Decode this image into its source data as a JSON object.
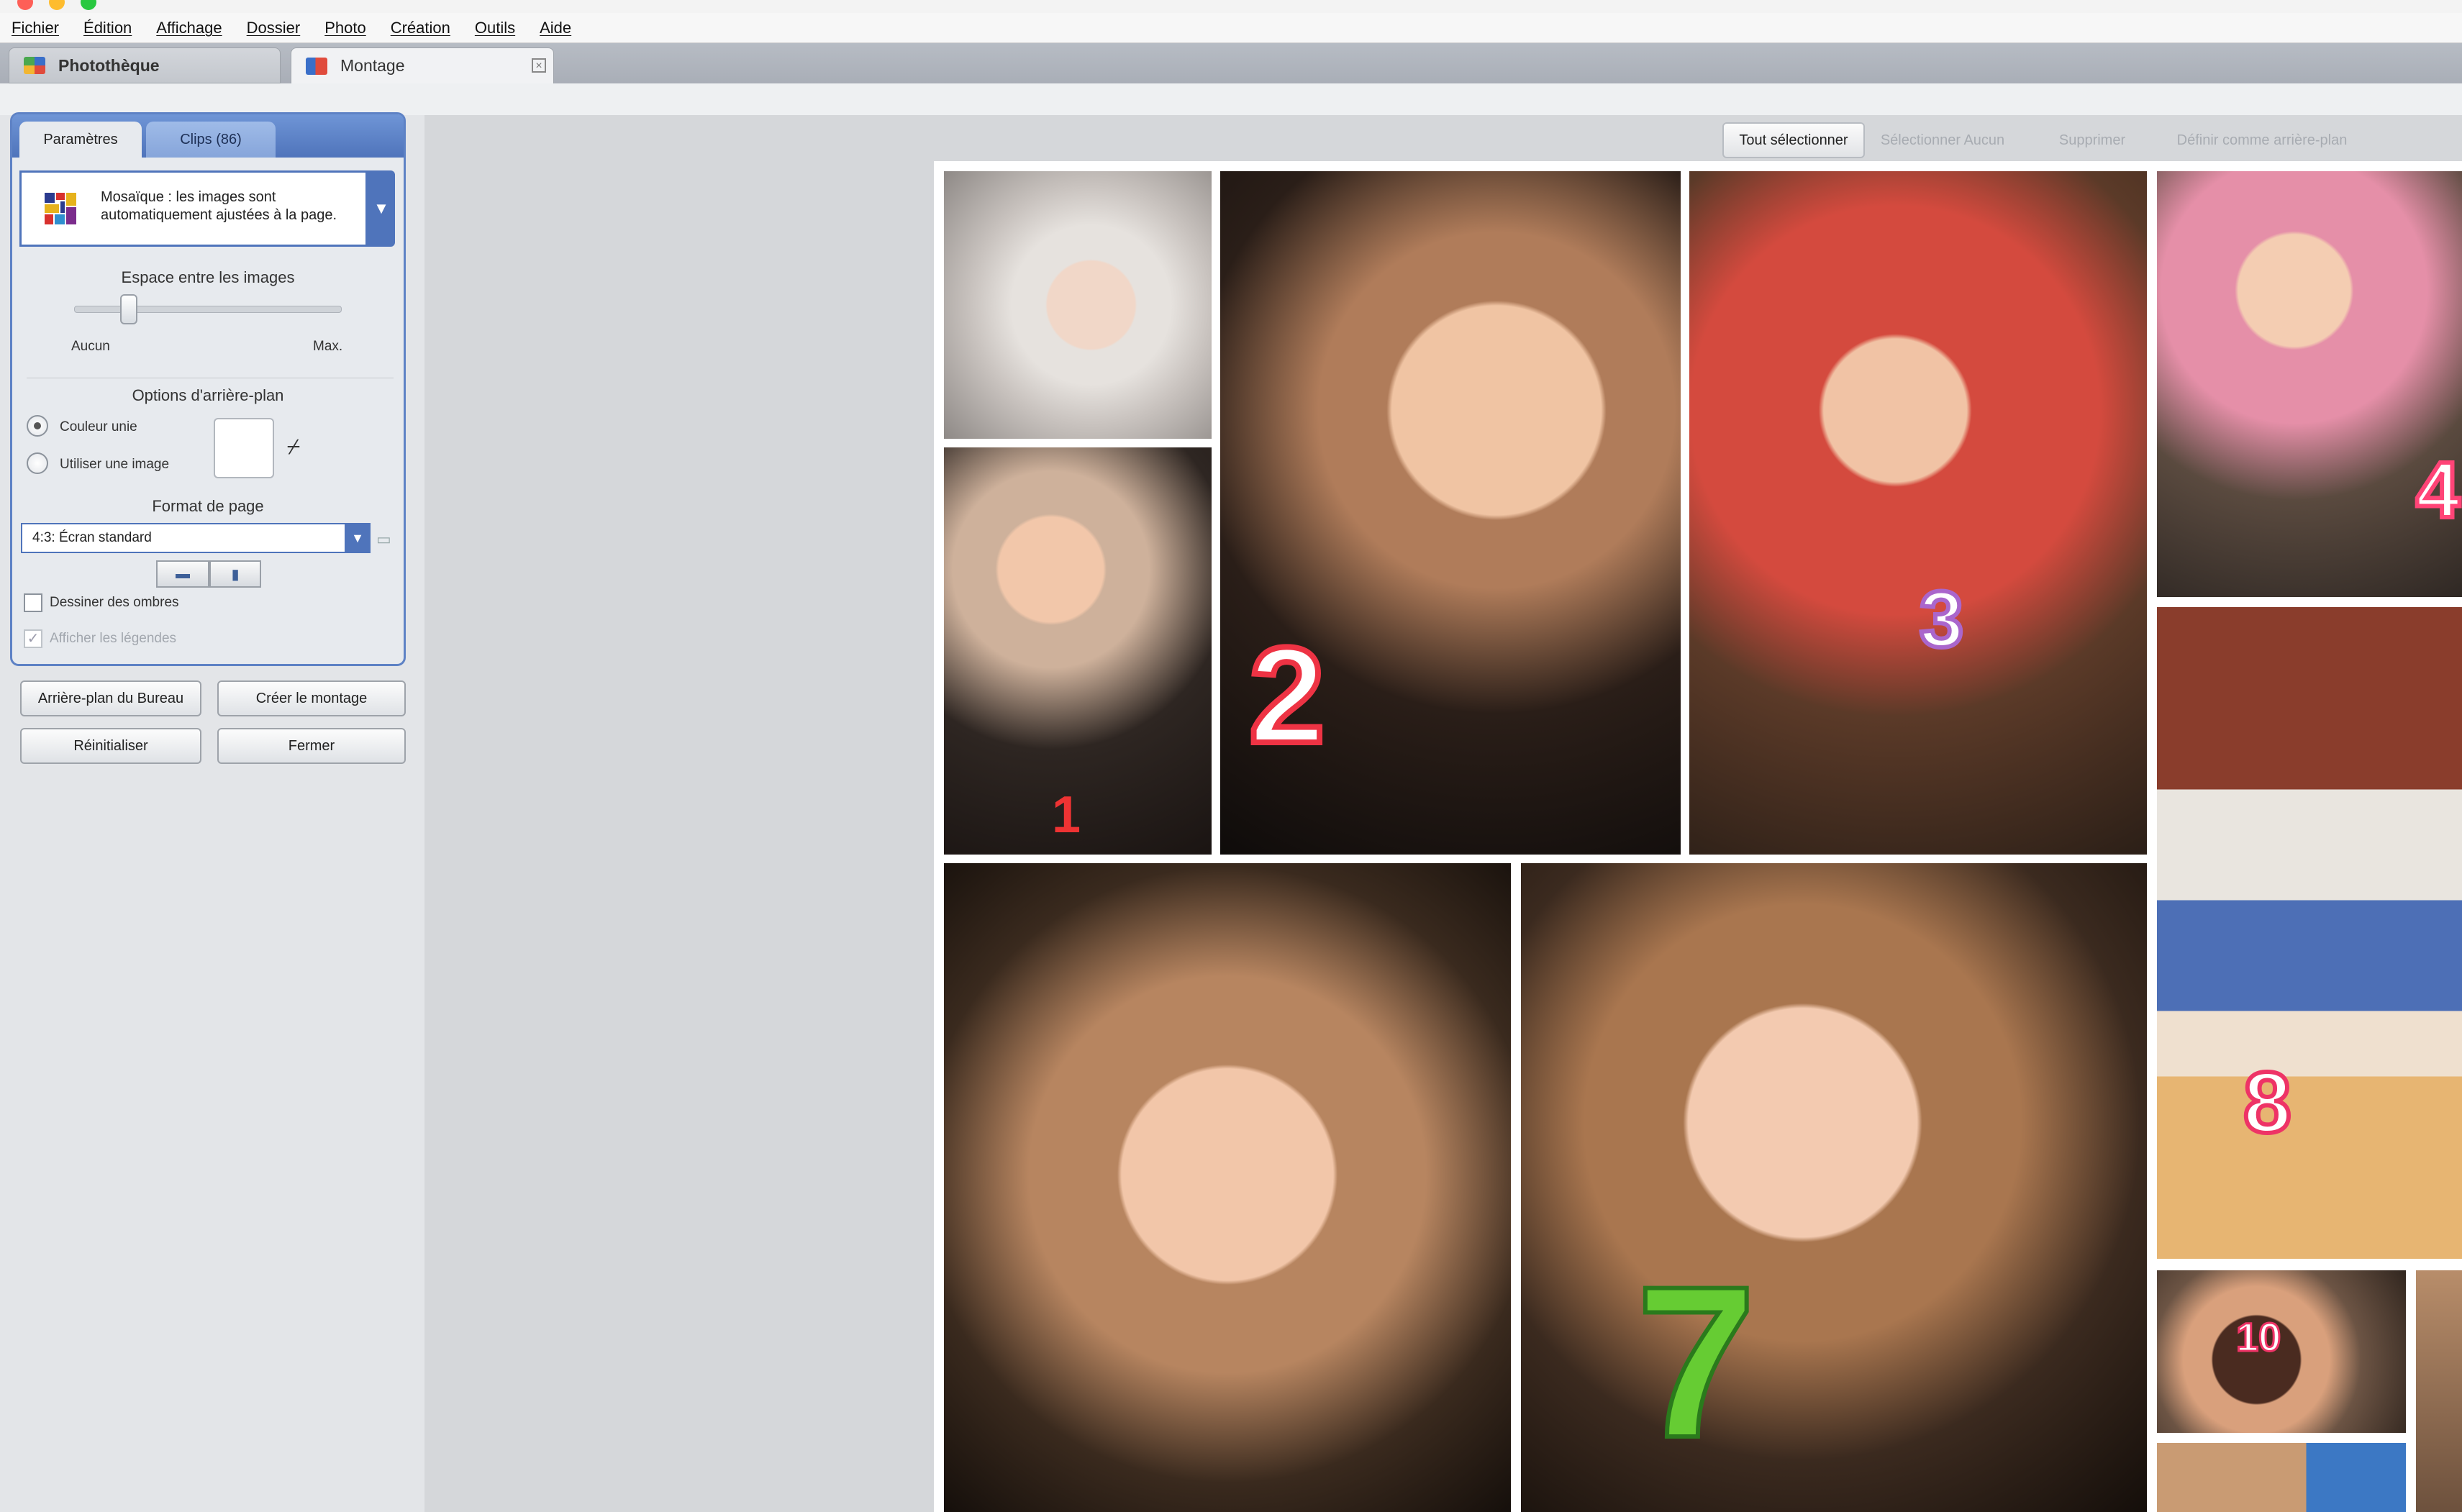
{
  "menubar": {
    "items": [
      "Fichier",
      "Édition",
      "Affichage",
      "Dossier",
      "Photo",
      "Création",
      "Outils",
      "Aide"
    ]
  },
  "tabs": {
    "library": "Photothèque",
    "montage": "Montage",
    "close_symbol": "⊠"
  },
  "panel": {
    "tab_params": "Paramètres",
    "tab_clips": "Clips (86)",
    "mosaic_text": "Mosaïque : les images sont automatiquement ajustées à la page.",
    "spacing_title": "Espace entre les images",
    "spacing_min": "Aucun",
    "spacing_max": "Max.",
    "spacing_level": 0.2,
    "bg_title": "Options d'arrière-plan",
    "radio_solid": "Couleur unie",
    "radio_image": "Utiliser une image",
    "format_title": "Format de page",
    "format_value": "4:3: Écran standard",
    "shadows_label": "Dessiner des ombres",
    "captions_label": "Afficher les légendes"
  },
  "buttons": {
    "desktop_bg": "Arrière-plan du Bureau",
    "create": "Créer le montage",
    "reset": "Réinitialiser",
    "close": "Fermer"
  },
  "toolbar": {
    "select_all": "Tout sélectionner",
    "select_none": "Sélectionner Aucun",
    "delete": "Supprimer",
    "set_background": "Définir comme arrière-plan"
  },
  "photos": [
    {
      "id": "newborn",
      "numeral": ""
    },
    {
      "id": "baby-and-dad",
      "numeral": "1"
    },
    {
      "id": "girl-cake-2",
      "numeral": "2"
    },
    {
      "id": "girl-cake-3",
      "numeral": "3"
    },
    {
      "id": "girl-pink-4",
      "numeral": "4"
    },
    {
      "id": "girl-closeup-left",
      "numeral": ""
    },
    {
      "id": "girl-7-dragon",
      "numeral": "7"
    },
    {
      "id": "girl-8-heart-cake",
      "numeral": "8"
    },
    {
      "id": "girl-10-cake",
      "numeral": "10"
    },
    {
      "id": "partial-photo",
      "numeral": ""
    }
  ],
  "colors": {
    "accent": "#4f74bb",
    "panel_border": "#5e82c5"
  }
}
